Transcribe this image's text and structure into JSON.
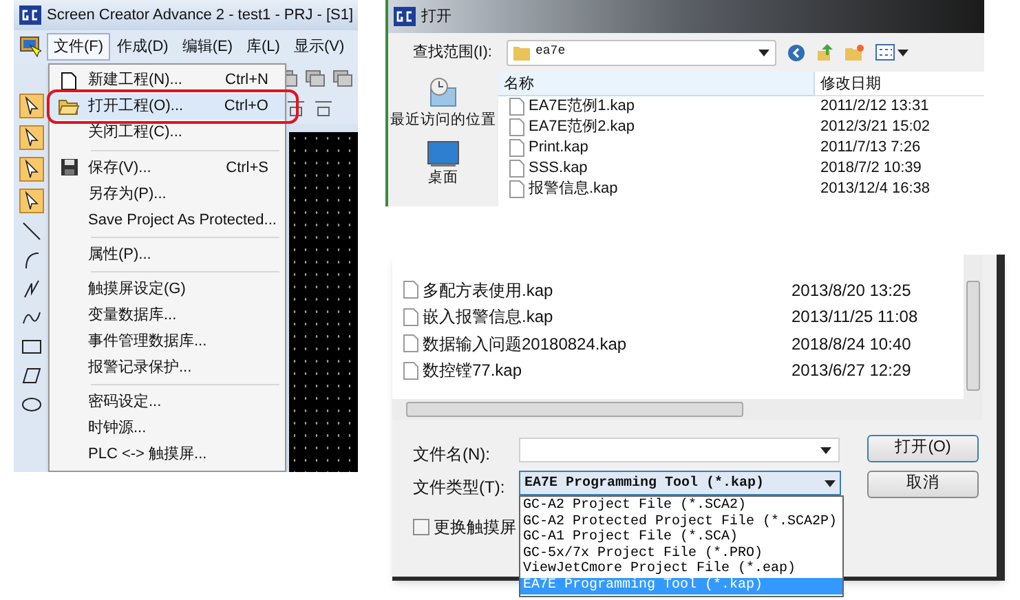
{
  "editor_window": {
    "title": "Screen Creator Advance 2 - test1 - PRJ - [S1]",
    "menu_bar": [
      {
        "label": "文件(F)",
        "selected": true
      },
      {
        "label": "作成(D)",
        "selected": false
      },
      {
        "label": "编辑(E)",
        "selected": false
      },
      {
        "label": "库(L)",
        "selected": false
      },
      {
        "label": "显示(V)",
        "selected": false
      }
    ],
    "file_menu": [
      {
        "kind": "item",
        "label": "新建工程(N)...",
        "shortcut": "Ctrl+N",
        "selected": false,
        "circled": false
      },
      {
        "kind": "item",
        "label": "打开工程(O)...",
        "shortcut": "Ctrl+O",
        "selected": true,
        "circled": true
      },
      {
        "kind": "item",
        "label": "关闭工程(C)...",
        "selected": false,
        "circled": false
      },
      {
        "kind": "separator"
      },
      {
        "kind": "item",
        "label": "保存(V)...",
        "shortcut": "Ctrl+S",
        "selected": false,
        "circled": false
      },
      {
        "kind": "item",
        "label": "另存为(P)...",
        "selected": false,
        "circled": false
      },
      {
        "kind": "item",
        "label": "Save Project As Protected...",
        "selected": false,
        "circled": false
      },
      {
        "kind": "separator"
      },
      {
        "kind": "item",
        "label": "属性(P)...",
        "selected": false,
        "circled": false
      },
      {
        "kind": "separator"
      },
      {
        "kind": "item",
        "label": "触摸屏设定(G)",
        "selected": false,
        "circled": false
      },
      {
        "kind": "item",
        "label": "变量数据库...",
        "selected": false,
        "circled": false
      },
      {
        "kind": "item",
        "label": "事件管理数据库...",
        "selected": false,
        "circled": false
      },
      {
        "kind": "item",
        "label": "报警记录保护...",
        "selected": false,
        "circled": false
      },
      {
        "kind": "separator"
      },
      {
        "kind": "item",
        "label": "密码设定...",
        "selected": false,
        "circled": false
      },
      {
        "kind": "item",
        "label": "时钟源...",
        "selected": false,
        "circled": false
      },
      {
        "kind": "item",
        "label": "PLC <-> 触摸屏...",
        "selected": false,
        "circled": false
      }
    ]
  },
  "open_dialog_top": {
    "title": "打开",
    "look_in_label": "查找范围(I):",
    "look_in_value": "ea7e",
    "places": [
      "最近访问的位置",
      "桌面"
    ],
    "columns": [
      "名称",
      "修改日期"
    ],
    "files": [
      {
        "name": "EA7E范例1.kap",
        "date": "2011/2/12 13:31"
      },
      {
        "name": "EA7E范例2.kap",
        "date": "2012/3/21 15:02"
      },
      {
        "name": "Print.kap",
        "date": "2011/7/13 7:26"
      },
      {
        "name": "SSS.kap",
        "date": "2018/7/2 10:39"
      },
      {
        "name": "报警信息.kap",
        "date": "2013/12/4 16:38"
      }
    ]
  },
  "open_dialog_bottom": {
    "files": [
      {
        "name": "多配方表使用.kap",
        "date": "2013/8/20 13:25"
      },
      {
        "name": "嵌入报警信息.kap",
        "date": "2013/11/25 11:08"
      },
      {
        "name": "数据输入问题20180824.kap",
        "date": "2018/8/24 10:40"
      },
      {
        "name": "数控镗77.kap",
        "date": "2013/6/27 12:29"
      }
    ],
    "file_name_label": "文件名(N):",
    "file_type_label": "文件类型(T):",
    "file_type_value": "EA7E Programming Tool (*.kap)",
    "file_type_options": [
      {
        "label": "GC-A2 Project File (*.SCA2)",
        "selected": false
      },
      {
        "label": "GC-A2 Protected Project File (*.SCA2P)",
        "selected": false
      },
      {
        "label": "GC-A1 Project File (*.SCA)",
        "selected": false
      },
      {
        "label": "GC-5x/7x Project File (*.PRO)",
        "selected": false
      },
      {
        "label": "ViewJetCmore Project File (*.eap)",
        "selected": false
      },
      {
        "label": "EA7E Programming Tool (*.kap)",
        "selected": true
      }
    ],
    "open_button": "打开(O)",
    "cancel_button": "取消",
    "checkbox": {
      "label": "更换触摸屏",
      "checked": false
    }
  }
}
